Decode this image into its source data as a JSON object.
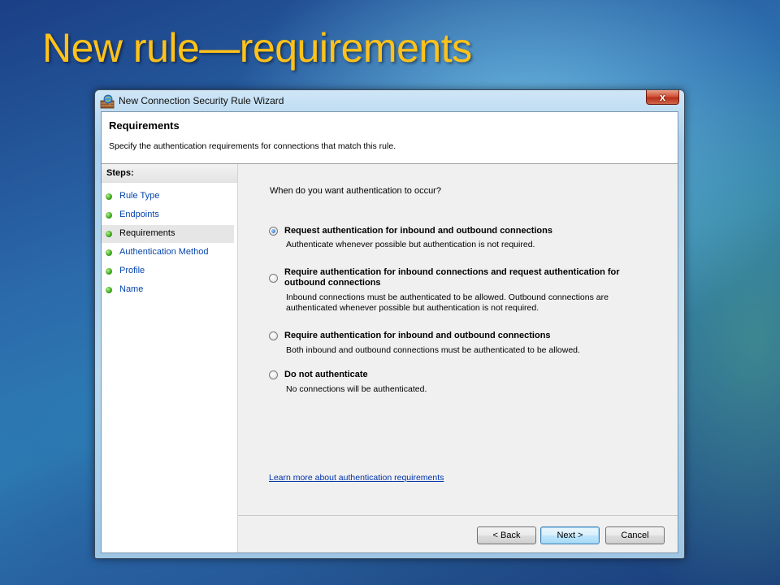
{
  "slide": {
    "title": "New rule—requirements"
  },
  "window": {
    "title": "New Connection Security Rule Wizard",
    "close_label": "x"
  },
  "header": {
    "title": "Requirements",
    "description": "Specify the authentication requirements for connections that match this rule."
  },
  "steps": {
    "label": "Steps:",
    "items": [
      {
        "label": "Rule Type"
      },
      {
        "label": "Endpoints"
      },
      {
        "label": "Requirements"
      },
      {
        "label": "Authentication Method"
      },
      {
        "label": "Profile"
      },
      {
        "label": "Name"
      }
    ],
    "active_index": 2
  },
  "main": {
    "question": "When do you want authentication to occur?",
    "options": [
      {
        "label": "Request authentication for inbound and outbound connections",
        "description": "Authenticate whenever possible but authentication is not required.",
        "selected": true
      },
      {
        "label": "Require authentication for inbound connections and request authentication for outbound connections",
        "description": "Inbound connections must be authenticated to be allowed. Outbound connections are authenticated whenever possible but authentication is not required.",
        "selected": false
      },
      {
        "label": "Require authentication for inbound and outbound connections",
        "description": "Both inbound and outbound connections must be authenticated to be allowed.",
        "selected": false
      },
      {
        "label": "Do not authenticate",
        "description": "No connections will be authenticated.",
        "selected": false
      }
    ],
    "help_link": "Learn more about authentication requirements"
  },
  "footer": {
    "back_label": "< Back",
    "next_label": "Next >",
    "cancel_label": "Cancel"
  }
}
